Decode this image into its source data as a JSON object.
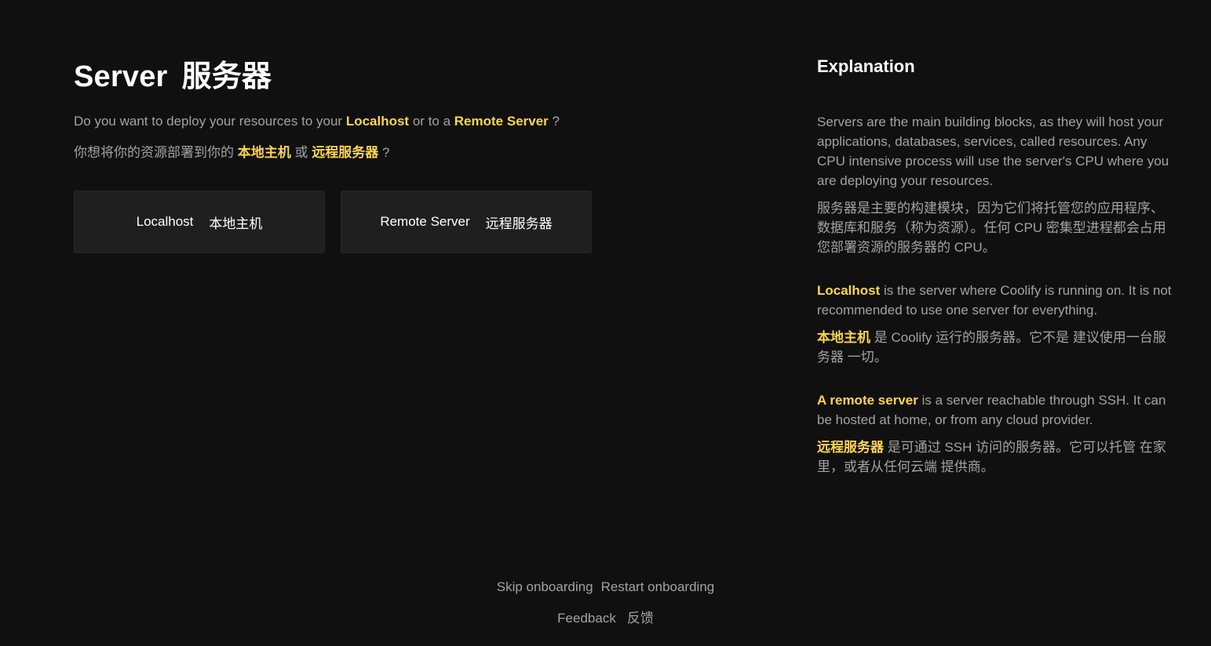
{
  "title": {
    "en": "Server",
    "zh": "服务器"
  },
  "question": {
    "en_prefix": "Do you want to deploy your resources to your",
    "en_localhost": "Localhost",
    "en_mid": "or to a",
    "en_remote": "Remote Server",
    "en_suffix": "?",
    "zh_prefix": "你想将你的资源部署到你的",
    "zh_localhost": "本地主机",
    "zh_mid": "或",
    "zh_remote": "远程服务器",
    "zh_suffix": "?"
  },
  "buttons": {
    "localhost_en": "Localhost",
    "localhost_zh": "本地主机",
    "remote_en": "Remote Server",
    "remote_zh": "远程服务器"
  },
  "explanation": {
    "title": "Explanation",
    "p1_en": "Servers are the main building blocks, as they will host your applications, databases, services, called resources. Any CPU intensive process will use the server's CPU where you are deploying your resources.",
    "p1_zh": "服务器是主要的构建模块，因为它们将托管您的应用程序、数据库和服务（称为资源）。任何 CPU 密集型进程都会占用您部署资源的服务器的 CPU。",
    "p2_en_highlight": "Localhost",
    "p2_en_rest": "is the server where Coolify is running on. It is not recommended to use one server for everything.",
    "p2_zh_highlight": "本地主机",
    "p2_zh_rest": "是 Coolify 运行的服务器。它不是 建议使用一台服务器 一切。",
    "p3_en_highlight": "A remote server",
    "p3_en_rest": "is a server reachable through SSH. It can be hosted at home, or from any cloud provider.",
    "p3_zh_highlight": "远程服务器",
    "p3_zh_rest": "是可通过 SSH 访问的服务器。它可以托管 在家里，或者从任何云端 提供商。"
  },
  "footer": {
    "skip": "Skip onboarding",
    "restart": "Restart onboarding",
    "feedback_en": "Feedback",
    "feedback_zh": "反馈"
  },
  "colors": {
    "background": "#101010",
    "button_bg": "#1f1f1f",
    "highlight": "#fcd452",
    "text": "#a3a3a3",
    "title": "#ffffff"
  }
}
